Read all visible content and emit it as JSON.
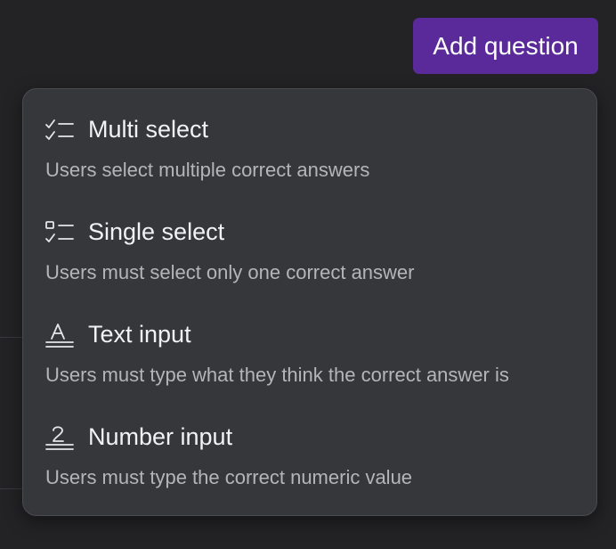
{
  "toolbar": {
    "add_question_label": "Add question"
  },
  "menu": {
    "items": [
      {
        "icon": "checklist-icon",
        "title": "Multi select",
        "description": "Users select multiple correct answers"
      },
      {
        "icon": "single-choice-list-icon",
        "title": "Single select",
        "description": "Users must select only one correct answer"
      },
      {
        "icon": "text-input-icon",
        "title": "Text input",
        "description": "Users must type what they think the correct answer is"
      },
      {
        "icon": "number-input-icon",
        "title": "Number input",
        "description": "Users must type the correct numeric value"
      }
    ]
  },
  "colors": {
    "background": "#232325",
    "menu_background": "#36373b",
    "accent": "#5b2a9a",
    "title_text": "#f2f2f4",
    "description_text": "#b4b5ba"
  }
}
